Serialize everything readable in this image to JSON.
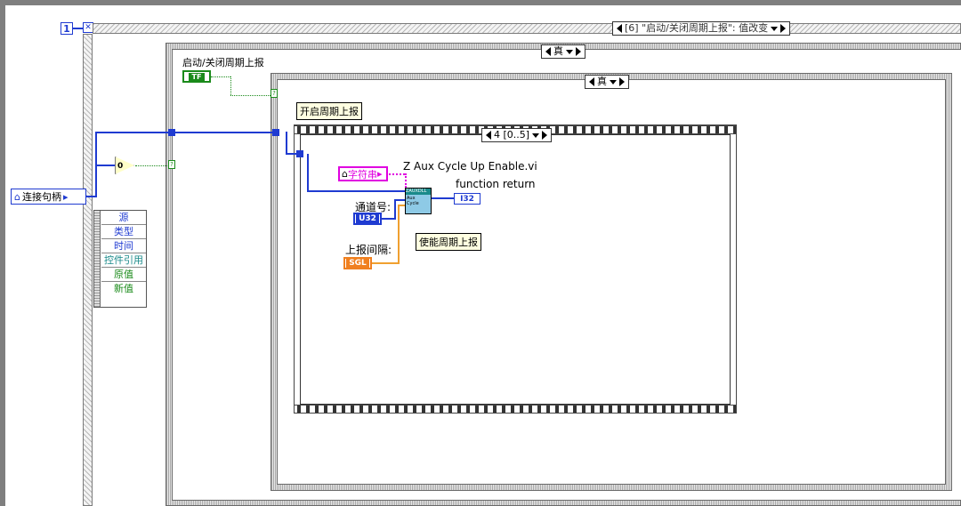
{
  "frame": {
    "index": "1",
    "event_case": "[6] \"启动/关闭周期上报\": 值改变",
    "outer_case": "真",
    "inner_case": "真",
    "sequence": "4 [0..5]"
  },
  "controls": {
    "connection_handle": "连接句柄",
    "toggle_label": "启动/关闭周期上报",
    "toggle_terminal": "TF",
    "zero_const": "0",
    "string_const": "字符串",
    "channel_label": "通道号:",
    "channel_terminal": "U32",
    "interval_label": "上报间隔:",
    "interval_terminal": "SGL",
    "return_label": "function return",
    "return_terminal": "I32"
  },
  "subvi": {
    "name": "Z Aux Cycle Up Enable.vi",
    "icon_text": "ZAUXDLL Aux Cycle"
  },
  "comments": {
    "open_cycle": "开启周期上报",
    "enable_cycle": "使能周期上报"
  },
  "event_data": [
    "源",
    "类型",
    "时间",
    "控件引用",
    "原值",
    "新值"
  ]
}
